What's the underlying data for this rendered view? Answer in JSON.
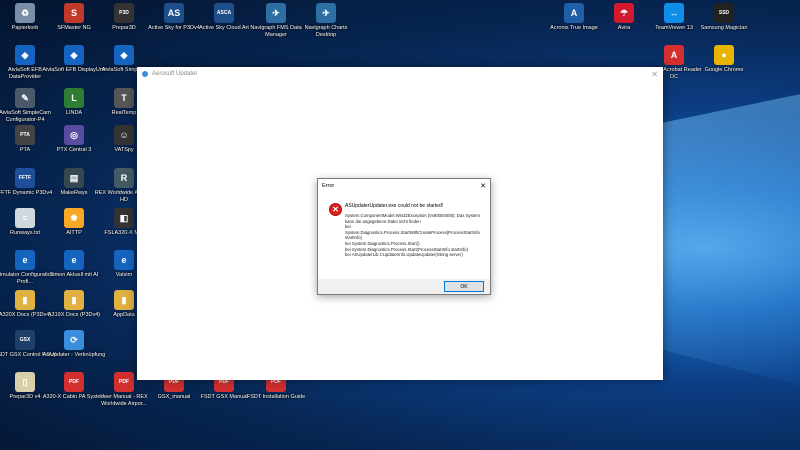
{
  "desktop": {
    "icons": [
      {
        "label": "Papierkorb",
        "color": "#7a8ea8",
        "glyph": "♻"
      },
      {
        "label": "SFMaster NG",
        "color": "#c0392b",
        "glyph": "S"
      },
      {
        "label": "Prepar3D",
        "color": "#333",
        "glyph": "P3D"
      },
      {
        "label": "Active Sky for P3Dv4",
        "color": "#1e4f8a",
        "glyph": "AS"
      },
      {
        "label": "Active Sky Cloud Art",
        "color": "#1e4f8a",
        "glyph": "ASCA"
      },
      {
        "label": "Navigraph FMS Data Manager",
        "color": "#2d6fa3",
        "glyph": "✈"
      },
      {
        "label": "Navigraph Charts Desktop",
        "color": "#2d6fa3",
        "glyph": "✈"
      },
      {
        "label": "Acronis True Image",
        "color": "#1f5fa8",
        "glyph": "A"
      },
      {
        "label": "Avira",
        "color": "#d3192e",
        "glyph": "☂"
      },
      {
        "label": "TeamViewer 13",
        "color": "#0e8ee9",
        "glyph": "↔"
      },
      {
        "label": "Samsung Magician",
        "color": "#222",
        "glyph": "SSD"
      },
      {
        "label": "AivlaSoft EFB DataProvider",
        "color": "#1565c0",
        "glyph": "◆"
      },
      {
        "label": "AivlaSoft EFB DisplayUnit",
        "color": "#1565c0",
        "glyph": "◆"
      },
      {
        "label": "AivlaSoft Simple...",
        "color": "#1565c0",
        "glyph": "◆"
      },
      {
        "label": "Adobe Acrobat Reader DC",
        "color": "#d32f2f",
        "glyph": "A"
      },
      {
        "label": "Google Chrome",
        "color": "#e8b400",
        "glyph": "●"
      },
      {
        "label": "AivlaSoft SimpleCam Configurator-P4",
        "color": "#4a5a6a",
        "glyph": "✎"
      },
      {
        "label": "LINDA",
        "color": "#2e7d32",
        "glyph": "L"
      },
      {
        "label": "RealTemp",
        "color": "#555",
        "glyph": "T"
      },
      {
        "label": "PTA",
        "color": "#444",
        "glyph": "PTA"
      },
      {
        "label": "PTX Central 3",
        "color": "#5a4aa0",
        "glyph": "◎"
      },
      {
        "label": "VATSpy",
        "color": "#333",
        "glyph": "☺"
      },
      {
        "label": "FFTF Dynamic P3Dv4",
        "color": "#1f4f99",
        "glyph": "FFTF"
      },
      {
        "label": "MakeRwys",
        "color": "#37474f",
        "glyph": "▤"
      },
      {
        "label": "REX Worldwide Airports HD",
        "color": "#455a64",
        "glyph": "R"
      },
      {
        "label": "Runways.txt",
        "color": "#cfd8dc",
        "glyph": "≡"
      },
      {
        "label": "AITTP",
        "color": "#f9a825",
        "glyph": "✹"
      },
      {
        "label": "FSLA320-X M...",
        "color": "#333",
        "glyph": "◧"
      },
      {
        "label": "Simulator Configuration Profi...",
        "color": "#1565c0",
        "glyph": "e"
      },
      {
        "label": "Simon Aktuell mit AI",
        "color": "#1565c0",
        "glyph": "e"
      },
      {
        "label": "Vatsim",
        "color": "#1565c0",
        "glyph": "e"
      },
      {
        "label": "A320X Docs (P3Dv4)",
        "color": "#e0b040",
        "glyph": "▮"
      },
      {
        "label": "A319X Docs (P3Dv4)",
        "color": "#e0b040",
        "glyph": "▮"
      },
      {
        "label": "AppData",
        "color": "#e0b040",
        "glyph": "▮"
      },
      {
        "label": "FSDT GSX Control Panel",
        "color": "#1f3f6a",
        "glyph": "GSX"
      },
      {
        "label": "ASUpdater - Verknüpfung",
        "color": "#3b8ddd",
        "glyph": "⟳"
      },
      {
        "label": "Prepar3D v4",
        "color": "#d8cfa8",
        "glyph": "▯"
      },
      {
        "label": "A320-X Cabin PA System",
        "color": "#d32f2f",
        "glyph": "PDF"
      },
      {
        "label": "User Manual - REX Worldwide Airpor...",
        "color": "#d32f2f",
        "glyph": "PDF"
      },
      {
        "label": "GSX_manual",
        "color": "#d32f2f",
        "glyph": "PDF"
      },
      {
        "label": "FSDT GSX Manual",
        "color": "#d32f2f",
        "glyph": "PDF"
      },
      {
        "label": "FSDT Installation Guide",
        "color": "#d32f2f",
        "glyph": "PDF"
      }
    ]
  },
  "app_window": {
    "title": "Aerosoft Updater",
    "close_glyph": "✕"
  },
  "error_dialog": {
    "title": "Error",
    "close_glyph": "✕",
    "icon_glyph": "✕",
    "heading": "ASUpdaterUpdater.exe could not be started!",
    "details": "System.ComponentModel.Win32Exception (0x80004005): Das System kann die angegebene Datei nicht finden\n   bei System.Diagnostics.Process.StartWithCreateProcess(ProcessStartInfo startInfo)\n   bei System.Diagnostics.Process.Start()\n   bei System.Diagnostics.Process.Start(ProcessStartInfo startInfo)\n   bei ASUpdaterLib.CUpdaterInfo.UpdateUpdater(String server)",
    "ok_label": "OK"
  }
}
